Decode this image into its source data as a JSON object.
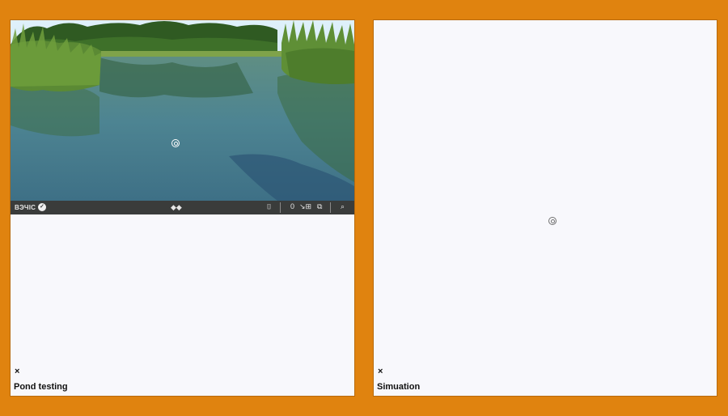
{
  "left_panel": {
    "video_bar": {
      "mode_label": "ВЭЧІС",
      "mode_icon": "check-circle-icon",
      "center_control": "◆◆",
      "controls": [
        {
          "icon": "folder-icon",
          "glyph": "⌷"
        },
        {
          "icon": "zero-counter",
          "glyph": "0"
        },
        {
          "icon": "split-icon",
          "glyph": "↘⊞"
        },
        {
          "icon": "layers-icon",
          "glyph": "⧉"
        },
        {
          "icon": "search-icon",
          "glyph": "⌕"
        }
      ]
    },
    "close_glyph": "×",
    "label": "Pond testing"
  },
  "right_panel": {
    "close_glyph": "×",
    "label": "Simuation"
  },
  "colors": {
    "frame": "#e0830f",
    "panel": "#f8f8fc",
    "video_bar": "#3a3c3b"
  }
}
